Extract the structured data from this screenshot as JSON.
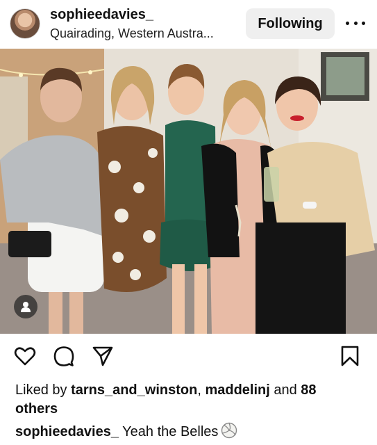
{
  "post": {
    "author": {
      "username": "sophieedavies_",
      "location": "Quairading, Western Austra..."
    },
    "follow_button_label": "Following",
    "more_icon": "more-horizontal-icon",
    "photo": {
      "description_icon": "photo",
      "tag_icon": "person-tag-icon"
    },
    "actions": {
      "like_icon": "heart-icon",
      "comment_icon": "comment-icon",
      "share_icon": "send-icon",
      "save_icon": "bookmark-icon"
    },
    "likes": {
      "prefix": "Liked by ",
      "user1": "tarns_and_winston",
      "separator": ", ",
      "user2": "maddelinj",
      "middle": " and ",
      "others_count": "88 others"
    },
    "caption": {
      "username": "sophieedavies_",
      "text": " Yeah the Belles",
      "emoji_icon": "volleyball-icon"
    }
  },
  "colors": {
    "button_bg": "#efefef",
    "text": "#111111"
  }
}
